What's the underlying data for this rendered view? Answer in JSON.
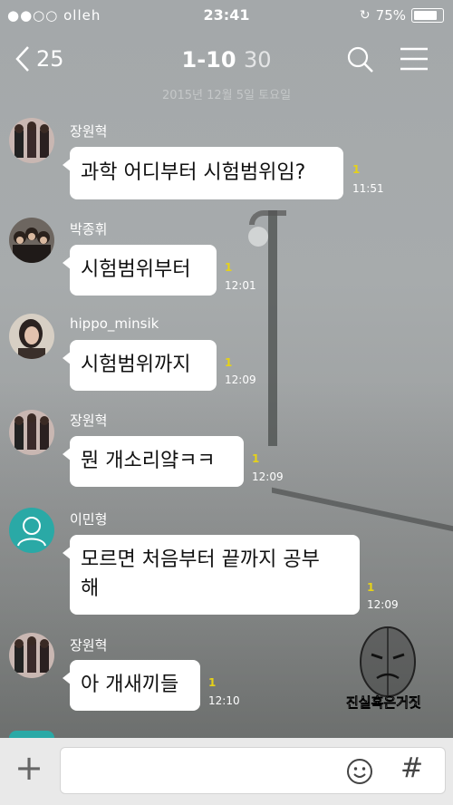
{
  "status_bar": {
    "carrier": "●●○○ olleh",
    "time": "23:41",
    "battery": "75%",
    "battery_level": 0.75
  },
  "nav": {
    "back_count": "25",
    "title": "1-10",
    "member_count": "30"
  },
  "date_divider": "2015년 12월 5일 토요일",
  "messages": [
    {
      "sender": "장원혁",
      "text": "과학 어디부터 시험범위임?",
      "unread": "1",
      "time": "11:51",
      "avatar": "group-photo-avatar"
    },
    {
      "sender": "박종휘",
      "text": "시험범위부터",
      "unread": "1",
      "time": "12:01",
      "avatar": "group-photo-avatar"
    },
    {
      "sender": "hippo_minsik",
      "text": "시험범위까지",
      "unread": "1",
      "time": "12:09",
      "avatar": "person-photo-avatar"
    },
    {
      "sender": "장원혁",
      "text": "뭔 개소리얔ㅋㅋ",
      "unread": "1",
      "time": "12:09",
      "avatar": "group-photo-avatar"
    },
    {
      "sender": "이민형",
      "text_line1": "모르면 처음부터 끝까지 공부",
      "text_line2": "해",
      "unread": "1",
      "time": "12:09",
      "avatar": "default-person-avatar"
    },
    {
      "sender": "장원혁",
      "text": "아 개새끼들",
      "unread": "1",
      "time": "12:10",
      "avatar": "group-photo-avatar"
    }
  ],
  "watermark": "진실혹은거짓",
  "input_bar": {
    "plus_label": "+",
    "hash_label": "#"
  },
  "colors": {
    "bubble": "#ffffff",
    "unread": "#e6d218",
    "default_avatar": "#2aa9a6",
    "input_bar": "#e9e9e9"
  }
}
